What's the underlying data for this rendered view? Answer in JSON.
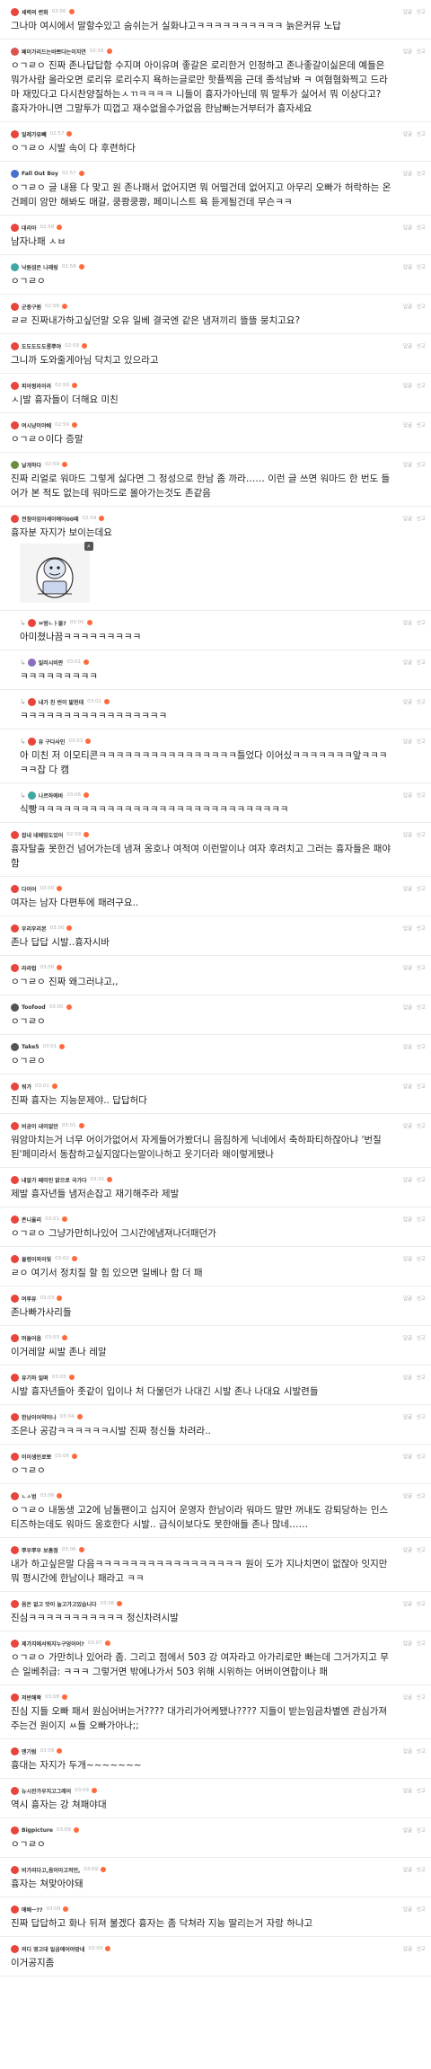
{
  "actions": {
    "reply": "답글",
    "report": "신고"
  },
  "comments": [
    {
      "name": "세력의 변화",
      "time": "02:56",
      "text": "그나마 여시에서 말할수있고 숨쉬는거 실화냐고ㅋㅋㅋㅋㅋㅋㅋㅋㅋㅋ 늙은커뮤 노답",
      "color": "#e8453c",
      "flag": true,
      "reply": false
    },
    {
      "name": "페이가리드는바쁘다는이지연",
      "time": "02:56",
      "text": "ㅇㄱㄹㅇ 진짜 존나답답함 수지며 아이유며 좋갈은 로리한거 인정하고 존나좋갈이싫은데 예들은 뭐가사람 올라오면 로리유 로리수지 욕하는글로만 핫플찍음 근데 종석남봐 ㅋ 여혐혐화찍고 드라마 재밌다고 다시찬양질하는ㅅㄲㅋㅋㅋㅋ 니들이 흉자가아닌데 뭐 말투가 싫어서 뭐 이상다고? 흉자가아니면 그말투가 띠껍고 재수없을수가없음 한남빠는거부터가 흉자세요",
      "color": "#d9534f",
      "flag": true,
      "reply": false
    },
    {
      "name": "일레가유빼",
      "time": "02:57",
      "text": "ㅇㄱㄹㅇ 시발 속이 다 후련하다",
      "color": "#e8453c",
      "flag": true,
      "reply": false
    },
    {
      "name": "Fall Out Boy",
      "time": "02:57",
      "text": "ㅇㄱㄹㅇ 글 내용 다 맞고 원 존나패서 없어지면 뭐 어떨건데 없어지고 아무리 오빠가 허락하는 온건페미 암만 해봐도 매갈, 쿵쾅쿵쾅, 페미니스트 욕 듣게될건데 무슨ㅋㅋ",
      "color": "#4a6fd1",
      "flag": true,
      "reply": false
    },
    {
      "name": "대리아",
      "time": "02:58",
      "text": "남자나패 ㅅㅂ",
      "color": "#e8453c",
      "flag": true,
      "reply": false
    },
    {
      "name": "낙원섬은 나래링",
      "time": "02:58",
      "text": "ㅇㄱㄹㅇ",
      "color": "#3fa7a3",
      "flag": true,
      "reply": false
    },
    {
      "name": "군중구원",
      "time": "02:58",
      "text": "ㄹㄹ 진짜내가하고싶던말 오유 일베 결국엔 같은 냄져끼리 뜰뜰 뭉치고요?",
      "color": "#e8453c",
      "flag": true,
      "reply": false
    },
    {
      "name": "도도도도도롱뿌야",
      "time": "02:59",
      "text": "그니까 도와줄게아님 닥치고 있으라고",
      "color": "#e8453c",
      "flag": true,
      "reply": false
    },
    {
      "name": "피아펑라이라",
      "time": "02:59",
      "text": "ㅅ|발 흉자들이 더해요 미친",
      "color": "#e8453c",
      "flag": true,
      "reply": false
    },
    {
      "name": "여시냥이야베",
      "time": "02:59",
      "text": "ㅇㄱㄹㅇ이다 증말",
      "color": "#e8453c",
      "flag": true,
      "reply": false
    },
    {
      "name": "날개하다",
      "time": "02:59",
      "text": "진짜 리얼로 워마드 그렇게 싫다면 그 정성으로 한남 좀 까라…… 이런 글 쓰면 워마드 한 번도 들어가 본 적도 없는데 워마드로 몰아가는것도 존같음",
      "color": "#6b8f3e",
      "flag": true,
      "reply": false
    },
    {
      "name": "전정아임아세아애아00때",
      "time": "02:59",
      "text": "흉자분 자지가 보이는데요",
      "color": "#e8453c",
      "flag": true,
      "reply": false,
      "image": true
    },
    {
      "name": "ㅂ벙ㄴㅏ믈?",
      "time": "03:00",
      "text": "아미쳤나끔ㅋㅋㅋㅋㅋㅋㅋㅋㅋ",
      "color": "#e8453c",
      "flag": true,
      "reply": true
    },
    {
      "name": "일러시비판",
      "time": "03:01",
      "text": "ㅋㅋㅋㅋㅋㅋㅋㅋㅋ",
      "color": "#8a6fbf",
      "flag": true,
      "reply": true
    },
    {
      "name": "내가 친 번이 밟헌데",
      "time": "03:01",
      "text": "ㅋㅋㅋㅋㅋㅋㅋㅋㅋㅋㅋㅋㅋㅋㅋㅋㅋ",
      "color": "#e8453c",
      "flag": true,
      "reply": true
    },
    {
      "name": "유 구다사인",
      "time": "03:03",
      "text": "아 미친 저 이모티콘ㅋㅋㅋㅋㅋㅋㅋㅋㅋㅋㅋㅋㅋㅋㅋㅋ틀었다 이어싰ㅋㅋㅋㅋㅋㅋㅋ앞ㅋㅋㅋㅋㅋ잡 다 캠",
      "color": "#e8453c",
      "flag": true,
      "reply": true
    },
    {
      "name": "나르하에바",
      "time": "03:06",
      "text": "식빵ㅋㅋㅋㅋㅋㅋㅋㅋㅋㅋㅋㅋㅋㅋㅋㅋㅋㅋㅋㅋㅋㅋㅋㅋㅋㅋㅋㅋㅋ",
      "color": "#3fa7a3",
      "flag": true,
      "reply": true
    },
    {
      "name": "잡내 네페밍도있어",
      "time": "02:59",
      "text": "흉자탈출 못한건 넘어가는데 냄져 옹호나 여적여 이런말이나 여자 후려치고 그러는 흉자들은 패야함",
      "color": "#e8453c",
      "flag": true,
      "reply": false
    },
    {
      "name": "다이어",
      "time": "03:00",
      "text": "여자는 남자 다편투에 패려구요..",
      "color": "#e8453c",
      "flag": true,
      "reply": false
    },
    {
      "name": "우리우리본",
      "time": "03:00",
      "text": "존나 답답 시발..흉자시바",
      "color": "#e8453c",
      "flag": true,
      "reply": false
    },
    {
      "name": "라라럽",
      "time": "03:00",
      "text": "ㅇㄱㄹㅇ 진짜 왜그러냐고,,",
      "color": "#e8453c",
      "flag": true,
      "reply": false
    },
    {
      "name": "Toofood",
      "time": "03:00",
      "text": "ㅇㄱㄹㅇ",
      "color": "#555555",
      "flag": true,
      "reply": false
    },
    {
      "name": "Take5",
      "time": "03:01",
      "text": "ㅇㄱㄹㅇ",
      "color": "#555555",
      "flag": true,
      "reply": false
    },
    {
      "name": "워가",
      "time": "03:01",
      "text": "진짜 흉자는 지능문제야.. 답답허다",
      "color": "#e8453c",
      "flag": true,
      "reply": false
    },
    {
      "name": "비공이 내이없던",
      "time": "03:01",
      "text": "워암마치는거 너무 어이가없어서 자게들어가봤더니 음침하게 닉네에서 축하파티하잖아냐 '번질된'페미라서 동참하고싶지않다는말이나하고 웃기더라 왜이렇게됐나",
      "color": "#e8453c",
      "flag": true,
      "reply": false
    },
    {
      "name": "내알가 페미인 밝으로 국가다",
      "time": "03:01",
      "text": "제발 흉자년들 냄저손잡고 재기해주라 제발",
      "color": "#e8453c",
      "flag": true,
      "reply": false
    },
    {
      "name": "존니율리",
      "time": "03:01",
      "text": "ㅇㄱㄹㅇ 그냥가만히나있어 그시간에냄져나더패던가",
      "color": "#e8453c",
      "flag": true,
      "reply": false
    },
    {
      "name": "물령이외이빛",
      "time": "03:02",
      "text": "ㄹㅇ 여기서 정치질 할 힘 있으면 일베나 함 더 패",
      "color": "#e8453c",
      "flag": true,
      "reply": false
    },
    {
      "name": "여루유",
      "time": "03:03",
      "text": "존나빠가사리들",
      "color": "#e8453c",
      "flag": true,
      "reply": false
    },
    {
      "name": "머들어옵",
      "time": "03:03",
      "text": "이거레알 씨발 존나 레알",
      "color": "#e8453c",
      "flag": true,
      "reply": false
    },
    {
      "name": "유기하 일뗘",
      "time": "03:03",
      "text": "시발 흉자년들아 좃같이 입이나 처 다물던가 나대긴 시발 존나 나대요 시발련들",
      "color": "#e8453c",
      "flag": true,
      "reply": false
    },
    {
      "name": "한남이어약이나",
      "time": "03:04",
      "text": "조은나 공감ㅋㅋㅋㅋㅋㅋ시발 진짜 정신들 차려라..",
      "color": "#e8453c",
      "flag": true,
      "reply": false
    },
    {
      "name": "이이생인로뽀",
      "time": "03:06",
      "text": "ㅇㄱㄹㅇ",
      "color": "#e8453c",
      "flag": true,
      "reply": false
    },
    {
      "name": "ㄴㅅ벙",
      "time": "03:06",
      "text": "ㅇㄱㄹㅇ 내동생 고2에 남돌팬이고 십지어 운영자 한남이라 워마드 말만 꺼내도 강퇴당하는 인스티즈하는데도 워마드 옹호한다 시발.. 급식이보다도 못한애들 존나 많네……",
      "color": "#e8453c",
      "flag": true,
      "reply": false
    },
    {
      "name": "뿌우뿌우 보홈점",
      "time": "03:06",
      "text": "내가 하고싶은말 다음ㅋㅋㅋㅋㅋㅋㅋㅋㅋㅋㅋㅋㅋㅋㅋㅋㅋ 원이 도가 지나치면이 없잖아 잇지만 뭐 평시간에 한남이나 패라고 ㅋㅋ",
      "color": "#e8453c",
      "flag": true,
      "reply": false
    },
    {
      "name": "음은 없고 맛이 늘고가고있습니다",
      "time": "03:06",
      "text": "진심ㅋㅋㅋㅋㅋㅋㅋㅋㅋㅋㅋ 정신차려시발",
      "color": "#e8453c",
      "flag": true,
      "reply": false
    },
    {
      "name": "제가지에서워지누구덩어어?",
      "time": "03:07",
      "text": "ㅇㄱㄹㅇ 가만히나 있어라 좀. 그리고 점에서 503 강 여자라고 아가리로만 빠는데 그거가지고 무슨 일베취급: ㅋㅋㅋ 그렇거면 밖에나가서 503 위해 시위하는 어버이연합이나 패",
      "color": "#e8453c",
      "flag": true,
      "reply": false
    },
    {
      "name": "저반해꽉",
      "time": "03:08",
      "text": "진심 지들 오빠 패서 원심어버는거???? 대가리가어케됐나???? 지들이 받는임금차별엔 관심가져주는건 원이지 ㅆ들 오빠가아나;;",
      "color": "#e8453c",
      "flag": true,
      "reply": false
    },
    {
      "name": "엔기럼",
      "time": "03:09",
      "text": "흉대는 자지가 두개~~~~~~~",
      "color": "#e8453c",
      "flag": true,
      "reply": false
    },
    {
      "name": "뉴시잔가우지고그레어",
      "time": "03:09",
      "text": "역시 흉자는 강 쳐패야대",
      "color": "#e8453c",
      "flag": true,
      "reply": false
    },
    {
      "name": "Bigpicture",
      "time": "03:09",
      "text": "ㅇㄱㄹㅇ",
      "color": "#e8453c",
      "flag": true,
      "reply": false
    },
    {
      "name": "비가리다고,음이아고저언,",
      "time": "03:09",
      "text": "흉자는 쳐맞아야돼",
      "color": "#e8453c",
      "flag": true,
      "reply": false
    },
    {
      "name": "애배ㅡ??",
      "time": "03:09",
      "text": "진짜 답답하고 화나 뒤져 불겠다 흉자는 좀 닥쳐라 지능 딸리는거 자랑 하냐고",
      "color": "#e8453c",
      "flag": true,
      "reply": false
    },
    {
      "name": "의디 영고대 일곰에어야망네",
      "time": "03:09",
      "text": "이거공지좀",
      "color": "#e8453c",
      "flag": true,
      "reply": false
    }
  ]
}
